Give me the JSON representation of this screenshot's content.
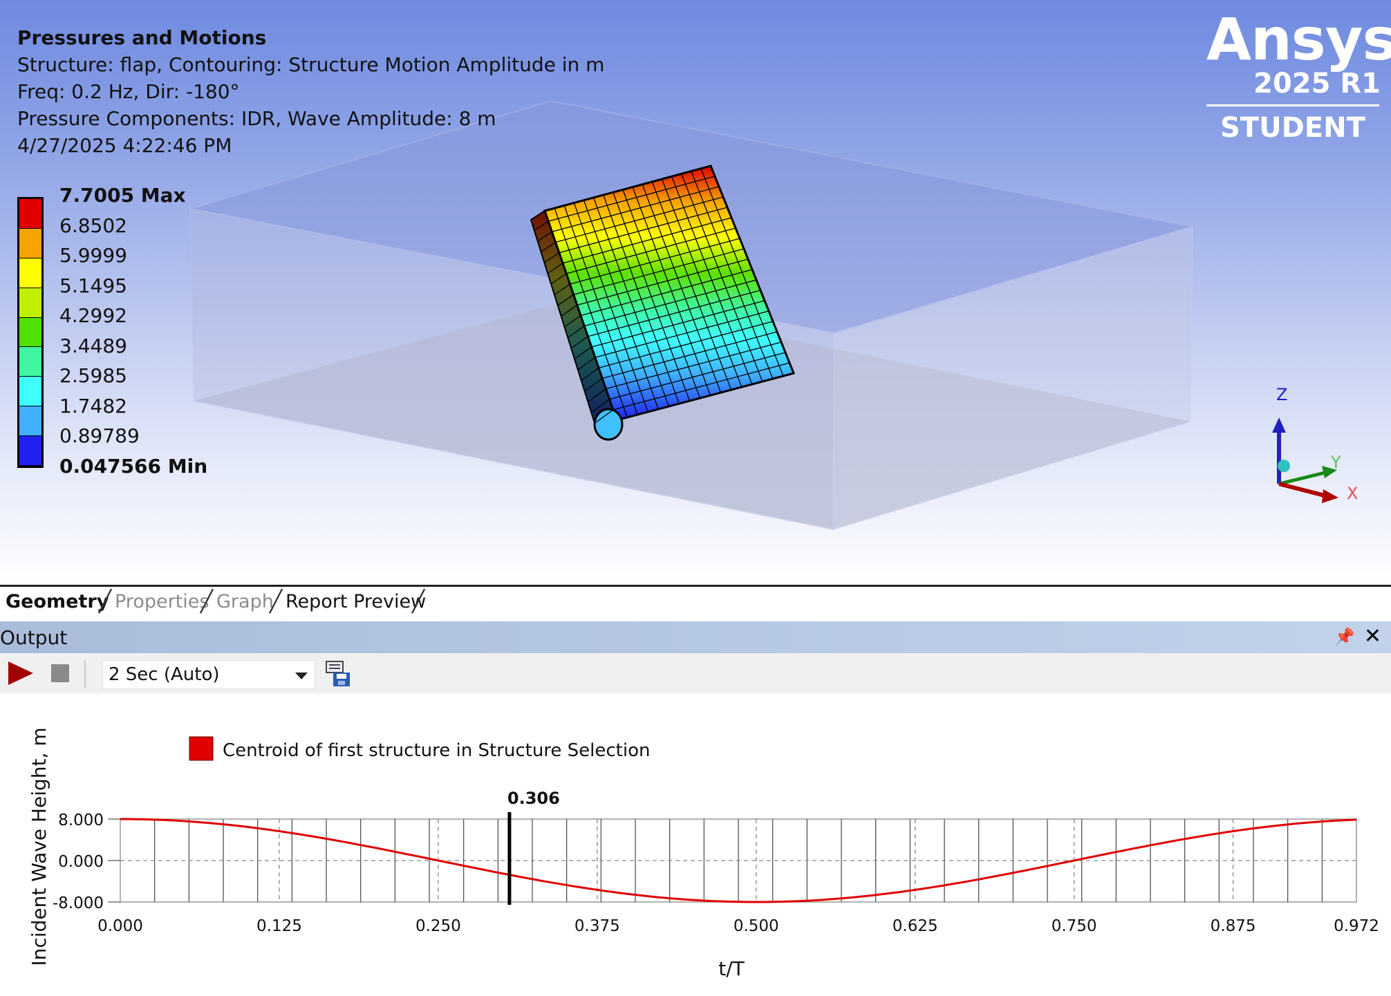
{
  "info": {
    "title": "Pressures and Motions",
    "line1": "Structure: flap, Contouring: Structure Motion Amplitude in m",
    "line2": "Freq: 0.2 Hz, Dir: -180°",
    "line3": "Pressure Components: IDR, Wave Amplitude: 8 m",
    "line4": "4/27/2025 4:22:46 PM"
  },
  "legend": {
    "labels": [
      "7.7005 Max",
      "6.8502",
      "5.9999",
      "5.1495",
      "4.2992",
      "3.4489",
      "2.5985",
      "1.7482",
      "0.89789",
      "0.047566 Min"
    ],
    "colors": [
      "#e00000",
      "#f5a300",
      "#ffff00",
      "#c0f000",
      "#50e000",
      "#40f5a0",
      "#40ffff",
      "#40b0ff",
      "#2020f0"
    ]
  },
  "logo": {
    "brand": "Ansys",
    "version": "2025 R1",
    "edition": "STUDENT"
  },
  "axes_triad": {
    "z": "Z",
    "y": "Y",
    "x": "X"
  },
  "tabs": [
    {
      "label": "Geometry",
      "active": true
    },
    {
      "label": "Properties",
      "active": false
    },
    {
      "label": "Graph",
      "active": false
    },
    {
      "label": "Report Preview",
      "active": false
    }
  ],
  "output": {
    "title": "Output",
    "speed": "2 Sec (Auto)",
    "icons": [
      "play-icon",
      "stop-icon",
      "export-icon",
      "pin-icon",
      "close-icon"
    ]
  },
  "chart_data": {
    "type": "line",
    "legend_entry": "Centroid of first structure in Structure Selection",
    "series_color": "#e00000",
    "xlabel": "t/T",
    "ylabel": "Incident Wave Height, m",
    "x_ticks": [
      "0.000",
      "0.125",
      "0.250",
      "0.375",
      "0.500",
      "0.625",
      "0.750",
      "0.875",
      "0.972"
    ],
    "y_ticks": [
      "8.000",
      "0.000",
      "-8.000"
    ],
    "xlim": [
      0,
      0.972
    ],
    "ylim": [
      -8,
      8
    ],
    "marker_value": "0.306",
    "marker_x": 0.306,
    "amplitude": 8,
    "frame_count": 36
  }
}
